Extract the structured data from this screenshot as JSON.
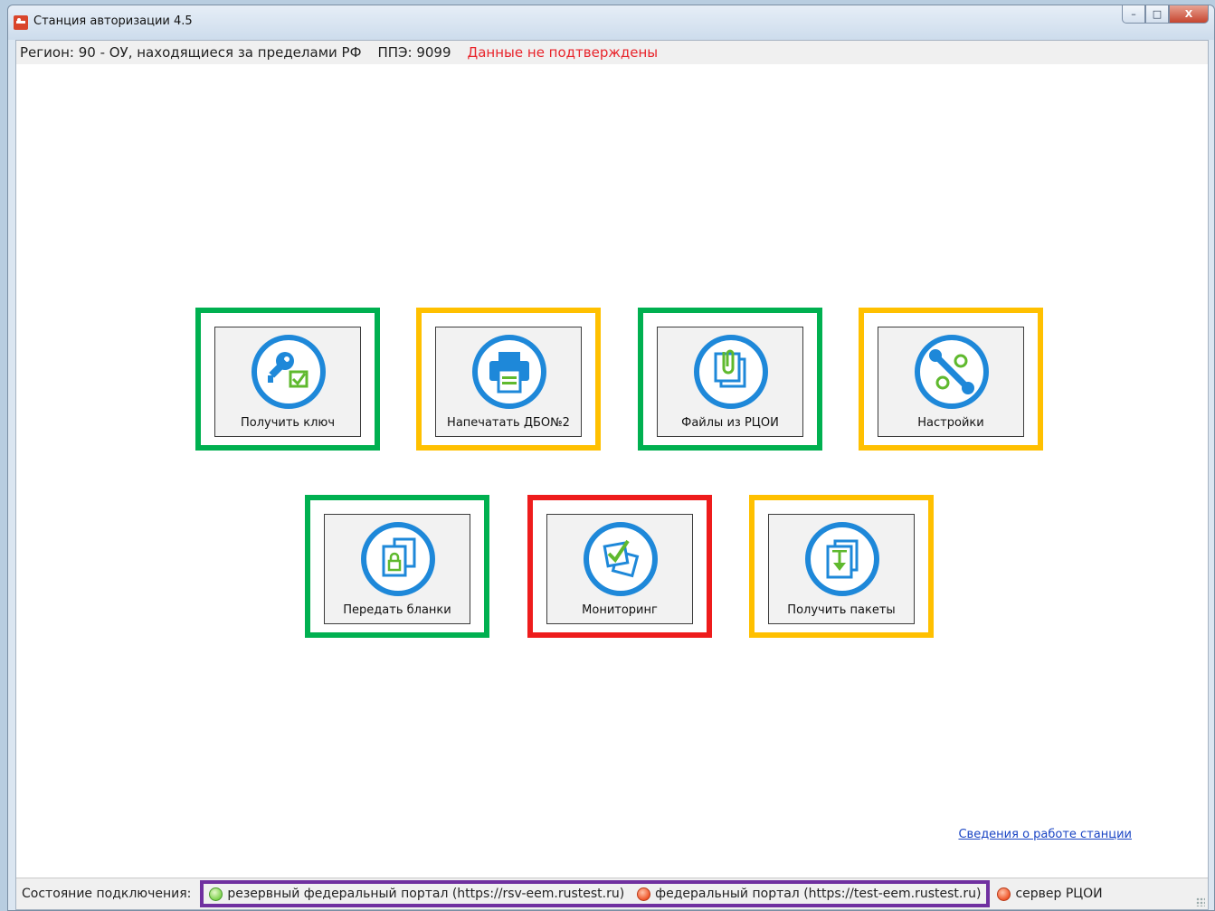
{
  "window": {
    "title": "Станция авторизации 4.5",
    "controls": {
      "minimize": "–",
      "maximize": "□",
      "close": "X"
    }
  },
  "info": {
    "region": "Регион: 90 - ОУ, находящиеся за пределами РФ",
    "ppe": "ППЭ: 9099",
    "warning": "Данные не подтверждены",
    "warning_color": "#e8242b"
  },
  "tiles": [
    {
      "label": "Получить ключ",
      "icon": "key-check-icon",
      "frame_color": "#00b050"
    },
    {
      "label": "Напечатать ДБО№2",
      "icon": "printer-icon",
      "frame_color": "#ffc000"
    },
    {
      "label": "Файлы из РЦОИ",
      "icon": "paperclip-files-icon",
      "frame_color": "#00b050"
    },
    {
      "label": "Настройки",
      "icon": "wrench-gears-icon",
      "frame_color": "#ffc000"
    },
    {
      "label": "Передать бланки",
      "icon": "locked-documents-icon",
      "frame_color": "#00b050"
    },
    {
      "label": "Мониторинг",
      "icon": "monitoring-check-icon",
      "frame_color": "#ee1c1c"
    },
    {
      "label": "Получить пакеты",
      "icon": "download-package-icon",
      "frame_color": "#ffc000"
    }
  ],
  "station_link": "Сведения о работе станции",
  "status": {
    "label": "Состояние подключения:",
    "connections": [
      {
        "label": "резервный федеральный портал (https://rsv-eem.rustest.ru)",
        "state": "green"
      },
      {
        "label": "федеральный портал (https://test-eem.rustest.ru)",
        "state": "red"
      },
      {
        "label": "сервер РЦОИ",
        "state": "red"
      }
    ],
    "group_highlight_color": "#7030a0"
  },
  "colors": {
    "icon_blue": "#1e88d9",
    "icon_green": "#5fb92e"
  }
}
